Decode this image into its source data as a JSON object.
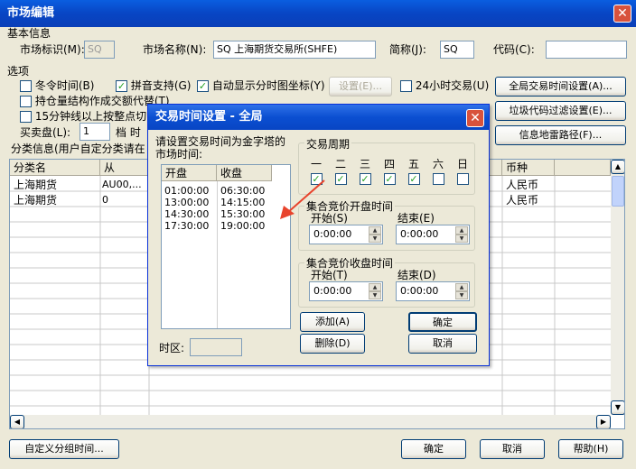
{
  "window": {
    "title": "市场编辑",
    "close": "✕"
  },
  "basic": {
    "section": "基本信息",
    "market_id_label": "市场标识(M):",
    "market_id_value": "SQ",
    "market_name_label": "市场名称(N):",
    "market_name_value": "SQ 上海期货交易所(SHFE)",
    "abbr_label": "简称(J):",
    "abbr_value": "SQ",
    "code_label": "代码(C):",
    "code_value": ""
  },
  "options": {
    "section": "选项",
    "winter_time": "冬令时间(B)",
    "pinyin": "拼音支持(G)",
    "auto_coord": "自动显示分时图坐标(Y)",
    "settings_btn": "设置(E)...",
    "h24": "24小时交易(U)",
    "global_time_btn": "全局交易时间设置(A)...",
    "hold_struct": "持仓量结构作成交额代替(T)",
    "garbage_btn": "垃圾代码过滤设置(E)...",
    "min15": "15分钟线以上按整点切分",
    "info_mine_btn": "信息地雷路径(F)...",
    "bidask_label": "买卖盘(L):",
    "bidask_value": "1",
    "tier_label": "档 时"
  },
  "category": {
    "label": "分类信息(用户自定分类请在",
    "headers": [
      "分类名",
      "从",
      "",
      "",
      "",
      "",
      "",
      "币种"
    ],
    "rows": [
      {
        "name": "上海期货",
        "from": "AU00,...",
        "cur": "人民币"
      },
      {
        "name": "上海期货",
        "from": "0",
        "cur": "人民币"
      }
    ]
  },
  "footer": {
    "custom_btn": "自定义分组时间...",
    "ok": "确定",
    "cancel": "取消",
    "help": "帮助(H)"
  },
  "dialog": {
    "title": "交易时间设置 - 全局",
    "close": "✕",
    "instruction": "请设置交易时间为金字塔的市场时间:",
    "cols": [
      "开盘",
      "收盘"
    ],
    "sessions": [
      [
        "01:00:00",
        "06:30:00"
      ],
      [
        "13:00:00",
        "14:15:00"
      ],
      [
        "14:30:00",
        "15:30:00"
      ],
      [
        "17:30:00",
        "19:00:00"
      ]
    ],
    "tz_label": "时区:",
    "tz_value": "",
    "period_label": "交易周期",
    "days": [
      {
        "d": "一",
        "c": "✓"
      },
      {
        "d": "二",
        "c": "✓"
      },
      {
        "d": "三",
        "c": "✓"
      },
      {
        "d": "四",
        "c": "✓"
      },
      {
        "d": "五",
        "c": "✓"
      },
      {
        "d": "六",
        "c": ""
      },
      {
        "d": "日",
        "c": ""
      }
    ],
    "open_auction": "集合竞价开盘时间",
    "close_auction": "集合竞价收盘时间",
    "start_label": "开始(S)",
    "end_label": "结束(E)",
    "start_label2": "开始(T)",
    "end_label2": "结束(D)",
    "oa_start": "0:00:00",
    "oa_end": "0:00:00",
    "ca_start": "0:00:00",
    "ca_end": "0:00:00",
    "add_btn": "添加(A)",
    "del_btn": "删除(D)",
    "ok": "确定",
    "cancel": "取消"
  },
  "colors": {
    "arrow": "#e8432c"
  }
}
